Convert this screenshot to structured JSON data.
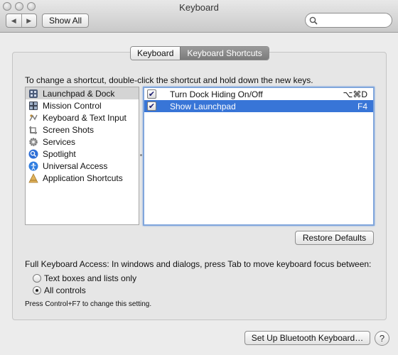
{
  "window": {
    "title": "Keyboard"
  },
  "toolbar": {
    "back_label": "◀",
    "forward_label": "▶",
    "show_all_label": "Show All",
    "search_placeholder": ""
  },
  "tabs": [
    {
      "label": "Keyboard",
      "active": false
    },
    {
      "label": "Keyboard Shortcuts",
      "active": true
    }
  ],
  "instruction": "To change a shortcut, double-click the shortcut and hold down the new keys.",
  "categories": [
    {
      "label": "Launchpad & Dock",
      "icon": "launchpad-icon",
      "selected": true
    },
    {
      "label": "Mission Control",
      "icon": "mission-control-icon",
      "selected": false
    },
    {
      "label": "Keyboard & Text Input",
      "icon": "keyboard-icon",
      "selected": false
    },
    {
      "label": "Screen Shots",
      "icon": "screenshot-icon",
      "selected": false
    },
    {
      "label": "Services",
      "icon": "gear-icon",
      "selected": false
    },
    {
      "label": "Spotlight",
      "icon": "spotlight-icon",
      "selected": false
    },
    {
      "label": "Universal Access",
      "icon": "universal-access-icon",
      "selected": false
    },
    {
      "label": "Application Shortcuts",
      "icon": "app-shortcuts-icon",
      "selected": false
    }
  ],
  "shortcuts": [
    {
      "label": "Turn Dock Hiding On/Off",
      "keys": "⌥⌘D",
      "checked": true,
      "selected": false
    },
    {
      "label": "Show Launchpad",
      "keys": "F4",
      "checked": true,
      "selected": true
    }
  ],
  "restore_defaults_label": "Restore Defaults",
  "full_access": {
    "label": "Full Keyboard Access: In windows and dialogs, press Tab to move keyboard focus between:",
    "options": [
      {
        "label": "Text boxes and lists only",
        "selected": false
      },
      {
        "label": "All controls",
        "selected": true
      }
    ],
    "hint": "Press Control+F7 to change this setting."
  },
  "bluetooth_button_label": "Set Up Bluetooth Keyboard…",
  "help_label": "?",
  "colors": {
    "selection_blue": "#3875d7",
    "focus_ring": "#80a6dc",
    "window_bg": "#ececec"
  }
}
